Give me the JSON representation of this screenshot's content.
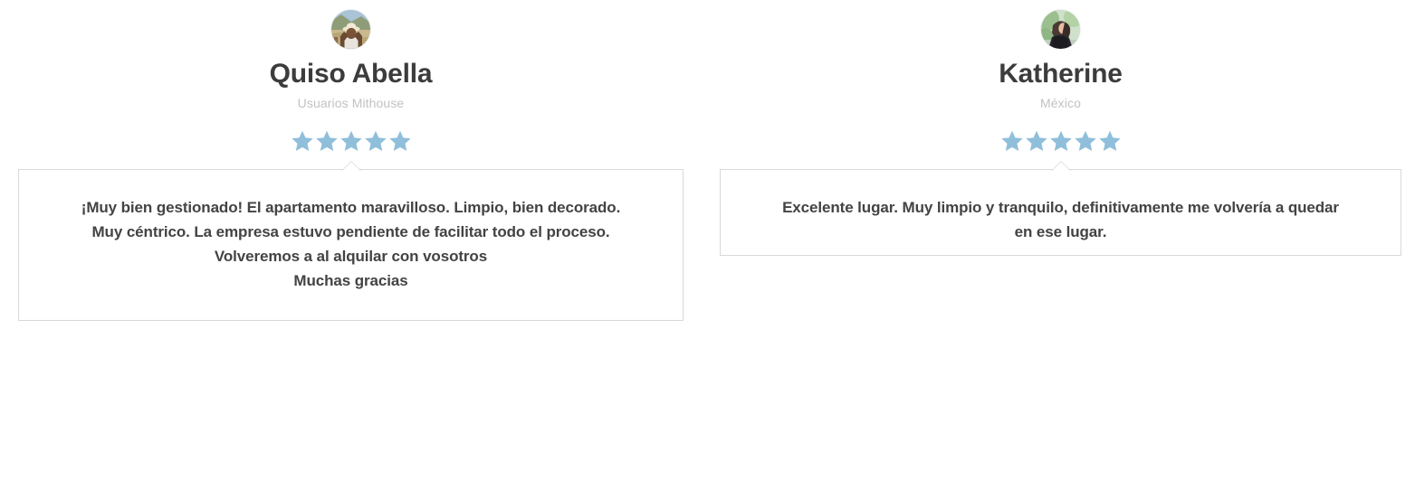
{
  "page": {
    "background_color": "#ffffff",
    "star_color": "#8fbfda",
    "name_color": "#3c3c3c",
    "subtitle_color": "#c2c2c2",
    "review_text_color": "#434343",
    "bubble_border_color": "#d8d8d8"
  },
  "testimonials": [
    {
      "avatar_name": "user-avatar-photo-person-with-hat",
      "name": "Quiso Abella",
      "subtitle": "Usuarios Mithouse",
      "rating": 5,
      "rating_label": "5 de 5 estrellas",
      "stars": [
        "★",
        "★",
        "★",
        "★",
        "★"
      ],
      "review": "¡Muy bien gestionado! El apartamento maravilloso. Limpio, bien decorado.\nMuy céntrico. La empresa estuvo pendiente de facilitar todo el proceso.\nVolveremos a al alquilar con vosotros\nMuchas gracias"
    },
    {
      "avatar_name": "user-avatar-photo-person-dark-hair",
      "name": "Katherine",
      "subtitle": "México",
      "rating": 5,
      "rating_label": "5 de 5 estrellas",
      "stars": [
        "★",
        "★",
        "★",
        "★",
        "★"
      ],
      "review": "Excelente lugar. Muy limpio y tranquilo, definitivamente me volvería a quedar\nen ese lugar."
    }
  ]
}
